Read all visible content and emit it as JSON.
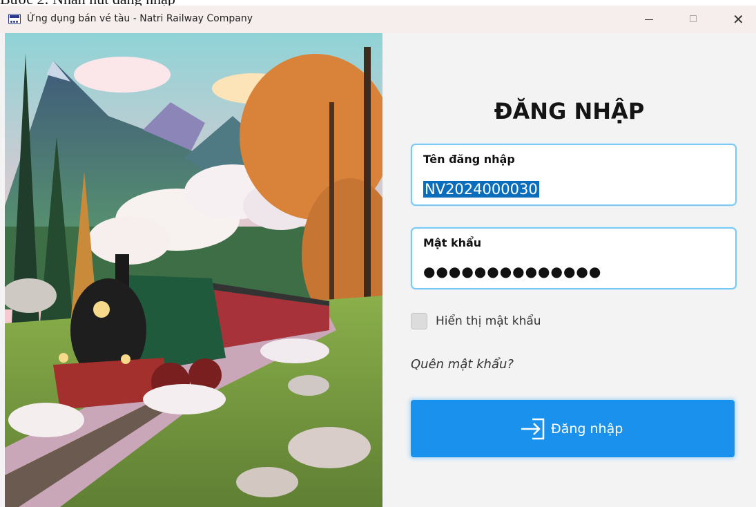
{
  "caption": {
    "text": "Bước 2: Nhấn nút đăng nhập"
  },
  "window": {
    "title": "Ứng dụng bán vé tàu - Natri Railway Company",
    "controls": {
      "minimize": "—",
      "maximize": "□",
      "close": "✕"
    }
  },
  "login": {
    "heading": "ĐĂNG NHẬP",
    "username": {
      "label": "Tên đăng nhập",
      "value": "NV2024000030"
    },
    "password": {
      "label": "Mật khẩu",
      "masked_value": "●●●●●●●●●●●●●●"
    },
    "show_password": {
      "label": "Hiển thị mật khẩu",
      "checked": false
    },
    "forgot_link": "Quên mật khẩu?",
    "submit": {
      "label": "Đăng nhập",
      "icon": "login-arrow-icon"
    }
  },
  "colors": {
    "accent": "#1a92ed",
    "field_border": "#7cc8f4",
    "selection": "#0b6ebd",
    "title_bar": "#f6eeec"
  }
}
